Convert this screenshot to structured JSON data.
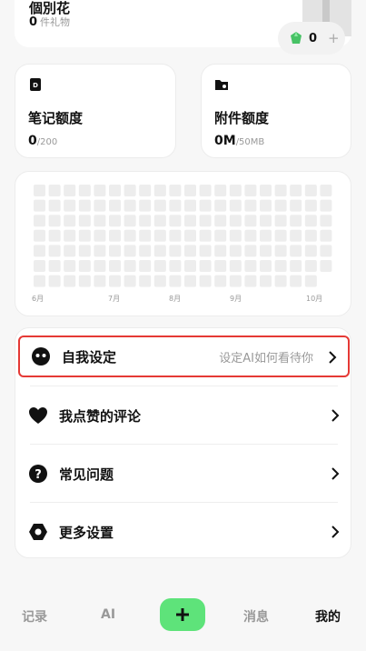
{
  "profile": {
    "partial_title": "個別花",
    "gift_count": "0",
    "gift_label": "件礼物",
    "gems": "0",
    "gem_plus": "+"
  },
  "quota": {
    "notes": {
      "label": "笔记额度",
      "used": "0",
      "limit": "/200"
    },
    "attachments": {
      "label": "附件额度",
      "used": "0M",
      "limit": "/50MB"
    }
  },
  "heatmap": {
    "months": [
      "6月",
      "7月",
      "8月",
      "9月",
      "10月"
    ]
  },
  "menu": {
    "persona": {
      "label": "自我设定",
      "hint": "设定AI如何看待你"
    },
    "liked": {
      "label": "我点赞的评论"
    },
    "faq": {
      "label": "常见问题"
    },
    "settings": {
      "label": "更多设置"
    }
  },
  "tabs": {
    "records": "记录",
    "ai": "AI",
    "messages": "消息",
    "mine": "我的"
  },
  "colors": {
    "accent": "#5ee37a",
    "highlight": "#e53935",
    "heat_cell": "#ededed"
  }
}
